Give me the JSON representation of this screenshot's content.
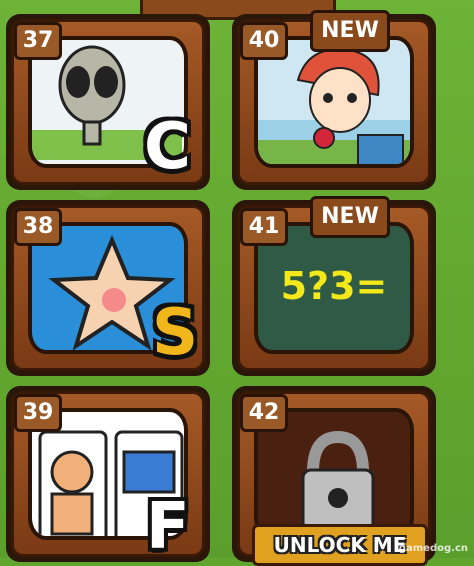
{
  "levels": [
    {
      "number": "37",
      "letter": "C",
      "badge": "",
      "art": "alien"
    },
    {
      "number": "40",
      "letter": "",
      "badge": "NEW",
      "art": "girl-with-rose"
    },
    {
      "number": "38",
      "letter": "S",
      "badge": "",
      "art": "star"
    },
    {
      "number": "41",
      "letter": "",
      "badge": "NEW",
      "art": "chalkboard",
      "chalk_text": "5?3="
    },
    {
      "number": "39",
      "letter": "F",
      "badge": "",
      "art": "strongman-card"
    },
    {
      "number": "42",
      "letter": "",
      "badge": "",
      "art": "locked",
      "unlock_label": "UNLOCK ME"
    }
  ],
  "watermark": "gamedog.cn",
  "colors": {
    "background": "#5fa52e",
    "frame": "#a55a26",
    "badge": "#8a4a1c",
    "unlock": "#e0a020",
    "chalkboard": "#2f5a45",
    "chalk": "#f3e81a"
  }
}
